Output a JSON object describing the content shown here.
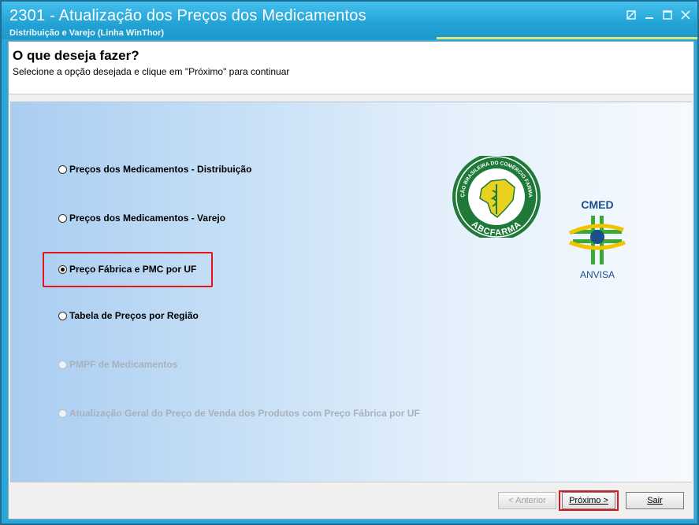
{
  "window": {
    "title": "2301 - Atualização dos Preços dos Medicamentos",
    "subtitle": "Distribuição e Varejo (Linha WinThor)"
  },
  "header": {
    "title": "O que deseja fazer?",
    "instruction": "Selecione a opção desejada e clique em \"Próximo\" para continuar"
  },
  "options": [
    {
      "label": "Preços dos Medicamentos - Distribuição",
      "selected": false,
      "enabled": true
    },
    {
      "label": "Preços dos Medicamentos - Varejo",
      "selected": false,
      "enabled": true
    },
    {
      "label": "Preço Fábrica e PMC por UF",
      "selected": true,
      "enabled": true
    },
    {
      "label": "Tabela de Preços por Região",
      "selected": false,
      "enabled": true
    },
    {
      "label": "PMPF de Medicamentos",
      "selected": false,
      "enabled": false
    },
    {
      "label": "Atualização Geral do Preço de Venda dos Produtos com Preço Fábrica por UF",
      "selected": false,
      "enabled": false
    }
  ],
  "logos": {
    "abcfarma_ring_text": "ASSOCIAÇÃO BRASILEIRA DO COMÉRCIO FARMACÊUTICO",
    "abcfarma_name": "ABCFARMA",
    "cmed_name": "CMED",
    "anvisa_name": "ANVISA"
  },
  "buttons": {
    "back": "< Anterior",
    "next": "Próximo >",
    "exit": "Sair"
  },
  "colors": {
    "titlebar": "#22a2d5",
    "highlight": "#e0161b",
    "abcfarma_green": "#1f7a3a",
    "cmed_blue": "#1b4f8a",
    "cmed_green": "#3aa935",
    "cmed_yellow": "#f2c400"
  }
}
